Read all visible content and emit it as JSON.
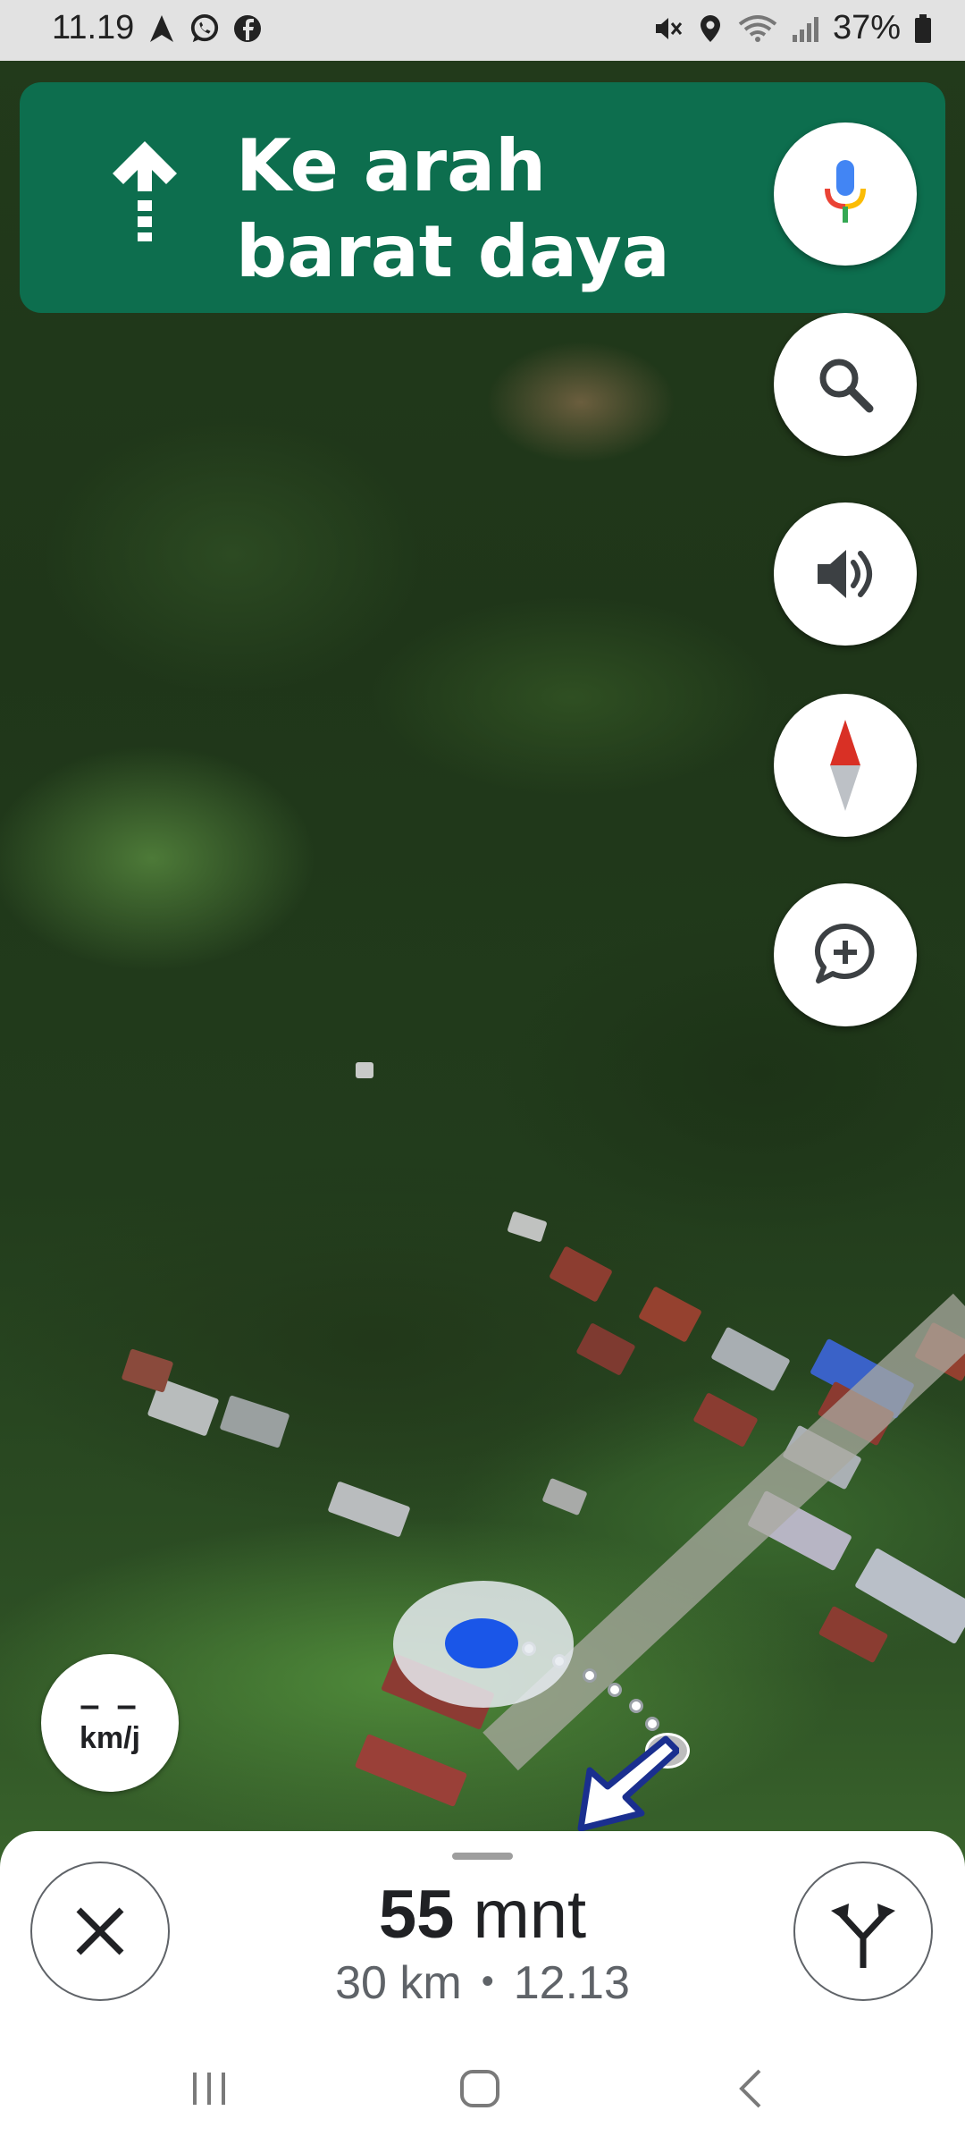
{
  "status_bar": {
    "time": "11.19",
    "battery": "37%",
    "left_icons": [
      "navigation-icon",
      "whatsapp-icon",
      "facebook-icon"
    ],
    "right_icons": [
      "mute-icon",
      "location-icon",
      "wifi-icon",
      "signal-icon",
      "battery-icon"
    ]
  },
  "banner": {
    "instruction": "Ke arah barat daya",
    "maneuver_icon": "straight-arrow-icon",
    "background": "#0d6e4e"
  },
  "map_controls": [
    "search-icon",
    "volume-icon",
    "compass-icon",
    "add-report-icon"
  ],
  "speed": {
    "value": "– –",
    "unit": "km/j"
  },
  "trip": {
    "duration_value": "55",
    "duration_unit": "mnt",
    "distance": "30 km",
    "separator": "•",
    "arrival_time": "12.13"
  },
  "bottom_buttons": {
    "close_icon": "close-icon",
    "alternate_routes_icon": "alt-route-icon"
  },
  "colors": {
    "accent_blue": "#1a56e8",
    "route_arrow": "#1a2f8f"
  }
}
